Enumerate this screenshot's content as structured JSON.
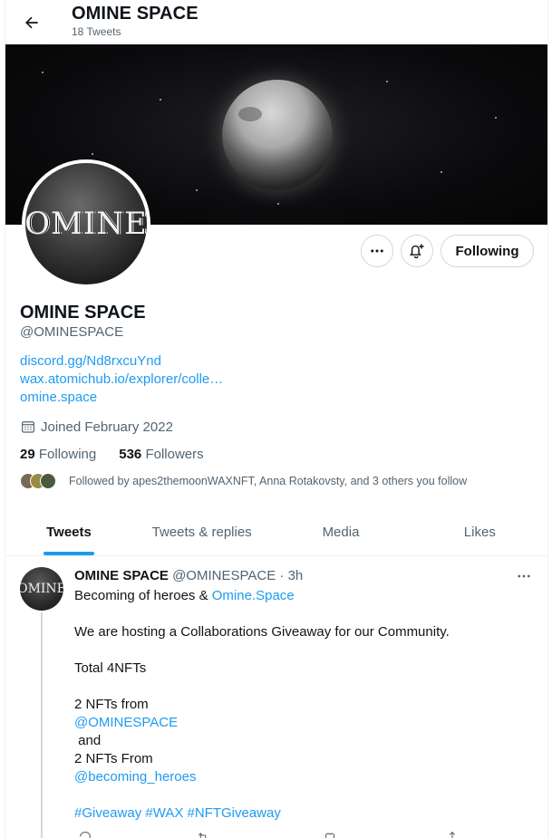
{
  "header": {
    "title": "OMINE SPACE",
    "tweet_count": "18 Tweets"
  },
  "profile": {
    "avatar_text": "OMINE",
    "name": "OMINE SPACE",
    "handle": "@OMINESPACE",
    "links": [
      "discord.gg/Nd8rxcuYnd",
      "wax.atomichub.io/explorer/colle…",
      "omine.space"
    ],
    "joined": "Joined February 2022",
    "following_count": "29",
    "following_label": "Following",
    "followers_count": "536",
    "followers_label": "Followers",
    "followed_by": "Followed by apes2themoonWAXNFT, Anna Rotakovsty, and 3 others you follow",
    "follow_button": "Following"
  },
  "tabs": [
    {
      "label": "Tweets",
      "active": true
    },
    {
      "label": "Tweets & replies",
      "active": false
    },
    {
      "label": "Media",
      "active": false
    },
    {
      "label": "Likes",
      "active": false
    }
  ],
  "tweet": {
    "avatar_text": "OMINE",
    "author": "OMINE SPACE",
    "handle": "@OMINESPACE",
    "sep": "·",
    "time": "3h",
    "line1_text": "Becoming of heroes & ",
    "line1_link": "Omine.Space",
    "line2": "We are hosting a Collaborations Giveaway for our Community.",
    "line3": "Total 4NFTs",
    "line4": "2 NFTs from",
    "mention1": "@OMINESPACE",
    "line5": " and",
    "line6": "2 NFTs From",
    "mention2": "@becoming_heroes",
    "hashtags": "#Giveaway #WAX #NFTGiveaway"
  },
  "icons": {
    "back": "arrow-left-icon",
    "more": "more-horizontal-icon",
    "bell": "bell-plus-icon",
    "calendar": "calendar-icon"
  },
  "colors": {
    "accent": "#1d9bf0",
    "text": "#0f1419",
    "secondary": "#536471"
  }
}
